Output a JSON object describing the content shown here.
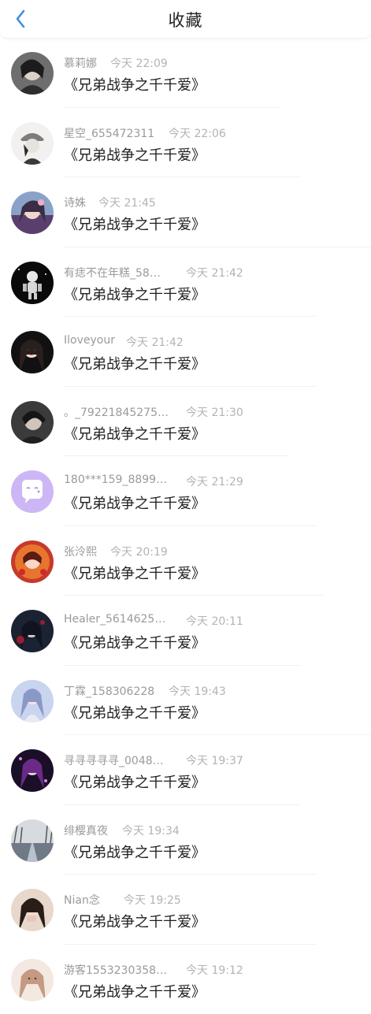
{
  "header": {
    "title": "收藏"
  },
  "items": [
    {
      "name": "慕莉娜",
      "time": "今天 22:09",
      "content": "《兄弟战争之千千爱》"
    },
    {
      "name": "星空_655472311",
      "time": "今天 22:06",
      "content": "《兄弟战争之千千爱》"
    },
    {
      "name": "诗姝",
      "time": "今天 21:45",
      "content": "《兄弟战争之千千爱》"
    },
    {
      "name": "有痣不在年糕_58…",
      "time": "今天 21:42",
      "content": "《兄弟战争之千千爱》"
    },
    {
      "name": "Iloveyour",
      "time": "今天 21:42",
      "content": "《兄弟战争之千千爱》"
    },
    {
      "name": "。_79221845275…",
      "time": "今天 21:30",
      "content": "《兄弟战争之千千爱》"
    },
    {
      "name": "180***159_8899…",
      "time": "今天 21:29",
      "content": "《兄弟战争之千千爱》"
    },
    {
      "name": "张泠熙",
      "time": "今天 20:19",
      "content": "《兄弟战争之千千爱》"
    },
    {
      "name": "Healer_5614625…",
      "time": "今天 20:11",
      "content": "《兄弟战争之千千爱》"
    },
    {
      "name": "丁霖_158306228",
      "time": "今天 19:43",
      "content": "《兄弟战争之千千爱》"
    },
    {
      "name": "寻寻寻寻寻_0048…",
      "time": "今天 19:37",
      "content": "《兄弟战争之千千爱》"
    },
    {
      "name": "绯樱真夜",
      "time": "今天 19:34",
      "content": "《兄弟战争之千千爱》"
    },
    {
      "name": "Nian念",
      "time": "今天 19:25",
      "content": "《兄弟战争之千千爱》"
    },
    {
      "name": "游客1553230358…",
      "time": "今天 19:12",
      "content": "《兄弟战争之千千爱》"
    }
  ],
  "colors": {
    "accent": "#3a8ee6",
    "default_avatar": "#cdb6f5"
  }
}
